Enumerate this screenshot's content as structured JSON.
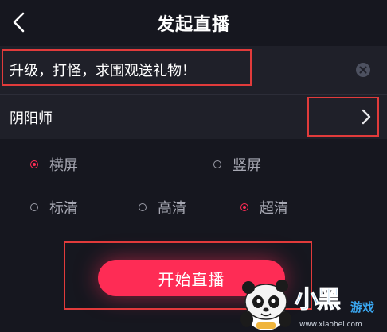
{
  "header": {
    "title": "发起直播",
    "back_icon": "chevron-left-icon"
  },
  "live_title": {
    "value": "升级，打怪，求围观送礼物！",
    "clear_icon": "clear-circle-icon"
  },
  "category": {
    "value": "阴阳师",
    "arrow_icon": "chevron-right-icon"
  },
  "orientation": {
    "options": [
      {
        "label": "横屏",
        "checked": true
      },
      {
        "label": "竖屏",
        "checked": false
      }
    ]
  },
  "quality": {
    "options": [
      {
        "label": "标清",
        "checked": false
      },
      {
        "label": "高清",
        "checked": false
      },
      {
        "label": "超清",
        "checked": true
      }
    ]
  },
  "start_button": {
    "label": "开始直播"
  },
  "watermark": {
    "brand": "小黑",
    "game": "游戏",
    "url": "www.xiaohei.com"
  },
  "colors": {
    "background": "#16171f",
    "accent": "#fe2c55",
    "annotation_border": "#e13b3b"
  }
}
